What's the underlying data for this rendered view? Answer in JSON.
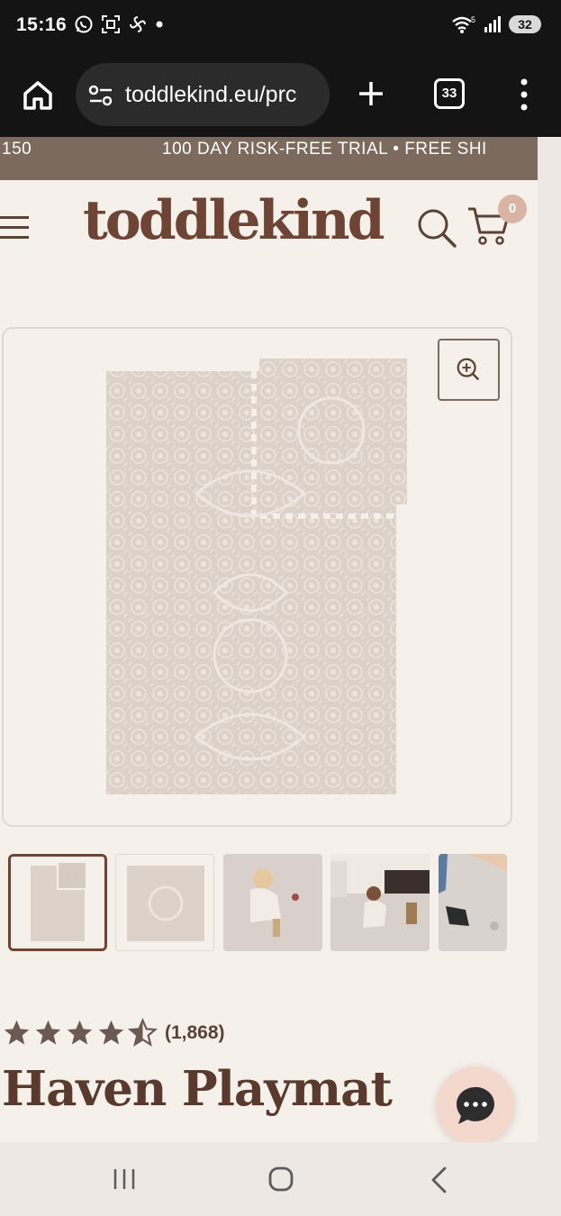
{
  "status_bar": {
    "time": "15:16",
    "notification_icons": [
      "whatsapp-icon",
      "screenshot-icon",
      "pinwheel-icon",
      "dot-icon"
    ],
    "battery": "32"
  },
  "browser": {
    "url": "toddlekind.eu/prc",
    "tab_count": "33"
  },
  "announcement": {
    "left_fragment": "150",
    "text": "100 DAY RISK-FREE TRIAL • FREE SHI"
  },
  "header": {
    "logo": "toddlekind",
    "cart_count": "0"
  },
  "product": {
    "rating_count": "(1,868)",
    "stars": 4.5,
    "title": "Haven Playmat"
  },
  "colors": {
    "brand_brown": "#6e4434",
    "announce_bg": "#7c6a5e",
    "page_bg": "#f6f0eb",
    "badge_bg": "#d9b3a3"
  }
}
